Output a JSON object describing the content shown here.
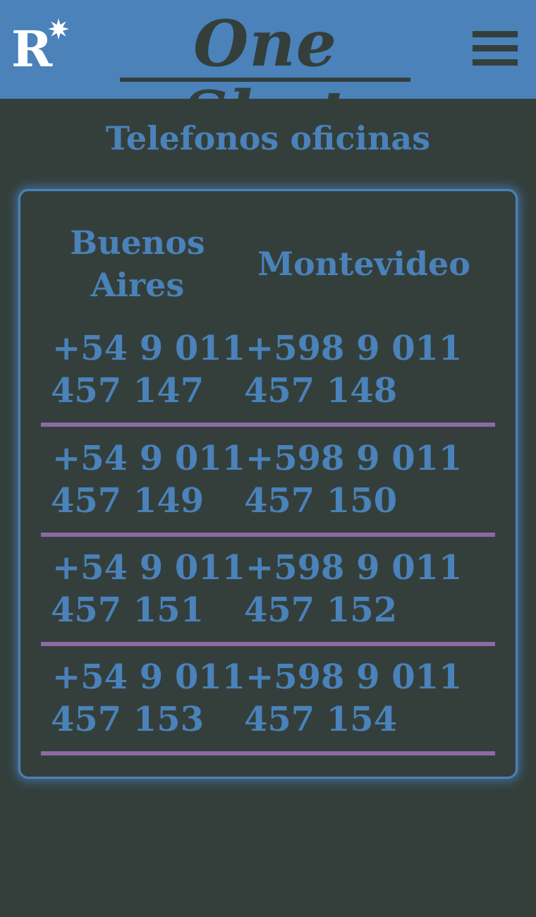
{
  "header": {
    "logo_letter": "R",
    "brand": "One Shot",
    "menu_icon": "hamburger-menu-icon",
    "background_color": "#4a82b9"
  },
  "page": {
    "title": "Telefonos oficinas",
    "background_color": "#343f3c",
    "accent_color": "#4a82b9",
    "divider_color": "#8d6aa3"
  },
  "table": {
    "headers": [
      "Buenos Aires",
      "Montevideo"
    ],
    "header_lines": {
      "buenos_aires": [
        "Buenos",
        "Aires"
      ],
      "montevideo": "Montevideo"
    },
    "rows": [
      {
        "buenos_aires": [
          "+54 9 011",
          "457 147"
        ],
        "montevideo": [
          "+598 9 011",
          "457 148"
        ]
      },
      {
        "buenos_aires": [
          "+54 9 011",
          "457 149"
        ],
        "montevideo": [
          "+598 9 011",
          "457 150"
        ]
      },
      {
        "buenos_aires": [
          "+54 9 011",
          "457 151"
        ],
        "montevideo": [
          "+598 9 011",
          "457 152"
        ]
      },
      {
        "buenos_aires": [
          "+54 9 011",
          "457 153"
        ],
        "montevideo": [
          "+598 9 011",
          "457 154"
        ]
      }
    ]
  }
}
